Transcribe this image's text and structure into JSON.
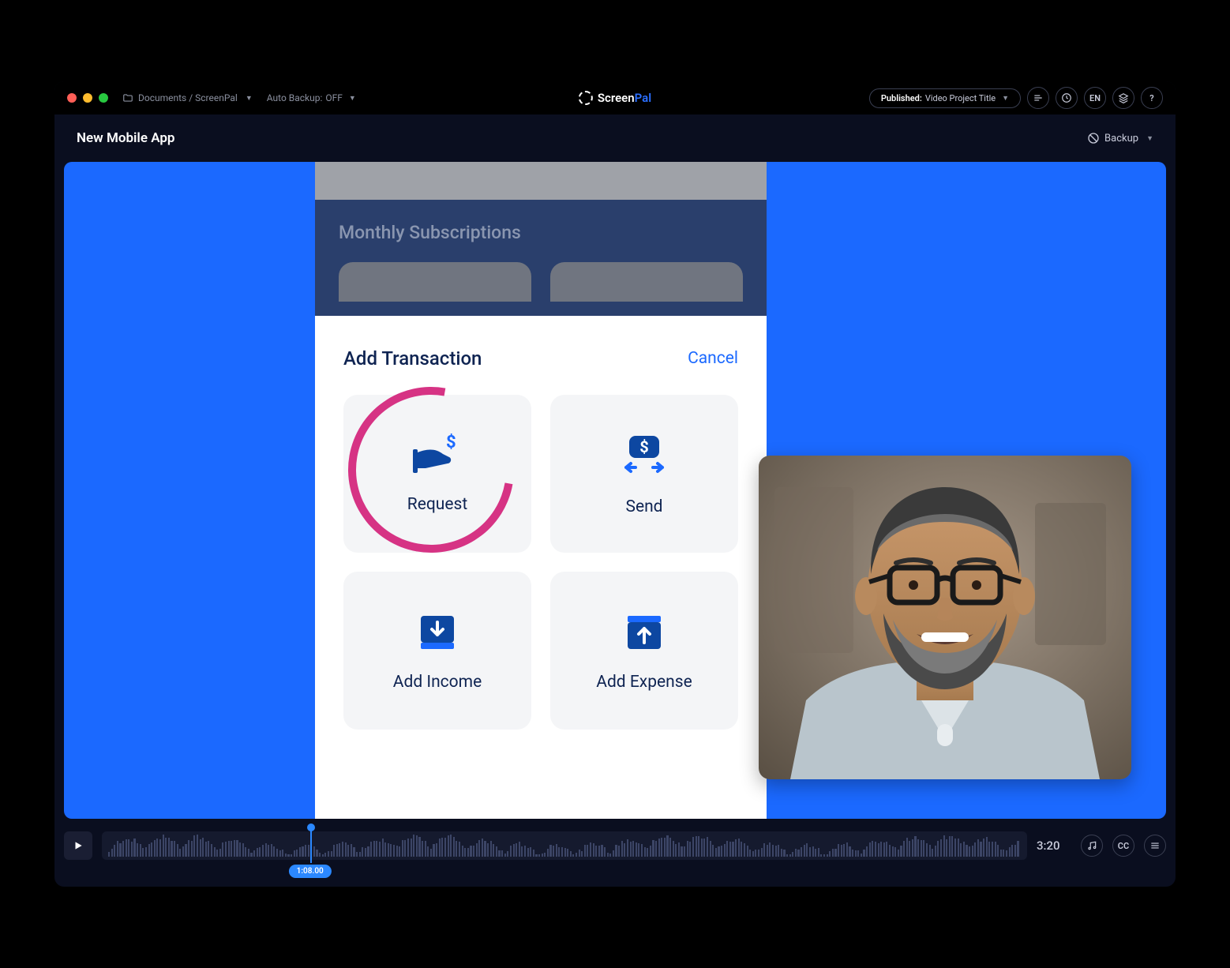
{
  "titlebar": {
    "breadcrumb": "Documents / ScreenPal",
    "auto_backup_label": "Auto Backup:",
    "auto_backup_status": "OFF",
    "brand_name": "Screen",
    "brand_suffix": "Pal",
    "publish_prefix": "Published:",
    "publish_title": "Video Project Title",
    "lang_code": "EN"
  },
  "subheader": {
    "title": "New Mobile App",
    "backup_label": "Backup"
  },
  "phone": {
    "section_title": "Monthly Subscriptions",
    "modal": {
      "title": "Add Transaction",
      "cancel": "Cancel",
      "tiles": {
        "request": "Request",
        "send": "Send",
        "add_income": "Add Income",
        "add_expense": "Add Expense"
      }
    }
  },
  "controls": {
    "playhead_time": "1:08.00",
    "total_time": "3:20"
  },
  "colors": {
    "accent_blue": "#1b69ff",
    "annotation_pink": "#d63384",
    "dark_bg": "#0a0e1f"
  }
}
